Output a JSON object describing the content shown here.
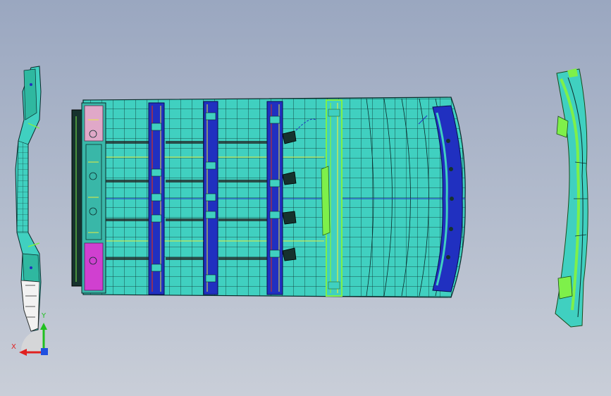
{
  "window": {
    "background_top": "#9aa7c0",
    "background_bottom": "#c9ced8"
  },
  "model": {
    "panel_fill": "#40d0c0",
    "mesh_color": "#0b2a2a",
    "rib_color": "#2030c0",
    "accent_green": "#7ef04a",
    "accent_yellow": "#e6ee40",
    "accent_magenta": "#d040d0",
    "accent_red": "#d03020"
  },
  "triad": {
    "x_label": "X",
    "y_label": "Y",
    "x_color": "#e02020",
    "y_color": "#20c020",
    "z_color": "#2050e0"
  }
}
